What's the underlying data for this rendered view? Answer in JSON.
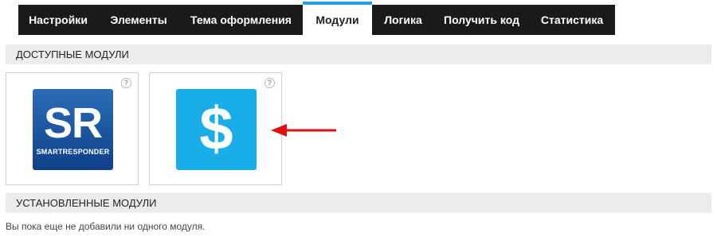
{
  "tabs": [
    {
      "label": "Настройки"
    },
    {
      "label": "Элементы"
    },
    {
      "label": "Тема оформления"
    },
    {
      "label": "Модули",
      "active": true
    },
    {
      "label": "Логика"
    },
    {
      "label": "Получить код"
    },
    {
      "label": "Статистика"
    }
  ],
  "available": {
    "title": "ДОСТУПНЫЕ МОДУЛИ",
    "modules": [
      {
        "logo_big": "SR",
        "logo_small": "SMARTRESPONDER",
        "icon": "smartresponder-logo",
        "help": "?"
      },
      {
        "logo_big": "$",
        "icon": "dollar-icon",
        "help": "?"
      }
    ]
  },
  "installed": {
    "title": "УСТАНОВЛЕННЫЕ МОДУЛИ",
    "empty_text": "Вы пока еще не добавили ни одного модуля."
  },
  "colors": {
    "tabbar_bg": "#1a1a1a",
    "active_accent": "#1ba1e2",
    "dollar_bg": "#1aaee8",
    "arrow": "#e01010"
  }
}
